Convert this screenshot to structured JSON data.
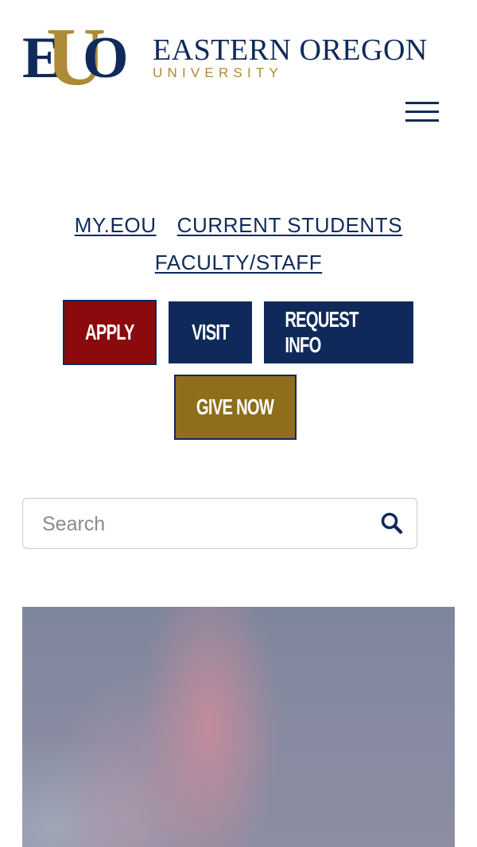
{
  "header": {
    "logo_mark_letters": {
      "e": "E",
      "u": "U",
      "o": "O"
    },
    "logo_title": "EASTERN OREGON",
    "logo_subtitle": "UNIVERSITY",
    "menu_icon": "hamburger-menu-icon"
  },
  "quick_links": [
    {
      "label": "MY.EOU"
    },
    {
      "label": "CURRENT STUDENTS"
    },
    {
      "label": "FACULTY/STAFF"
    }
  ],
  "cta_buttons": {
    "apply": "APPLY",
    "visit": "VISIT",
    "request_info": "REQUEST INFO",
    "give_now": "GIVE NOW"
  },
  "search": {
    "placeholder": "Search",
    "value": "",
    "icon": "search-icon"
  },
  "colors": {
    "navy": "#0f2a5a",
    "gold": "#ad8a35",
    "apply_red": "#8b0a0d",
    "give_gold": "#8e6e1b"
  }
}
